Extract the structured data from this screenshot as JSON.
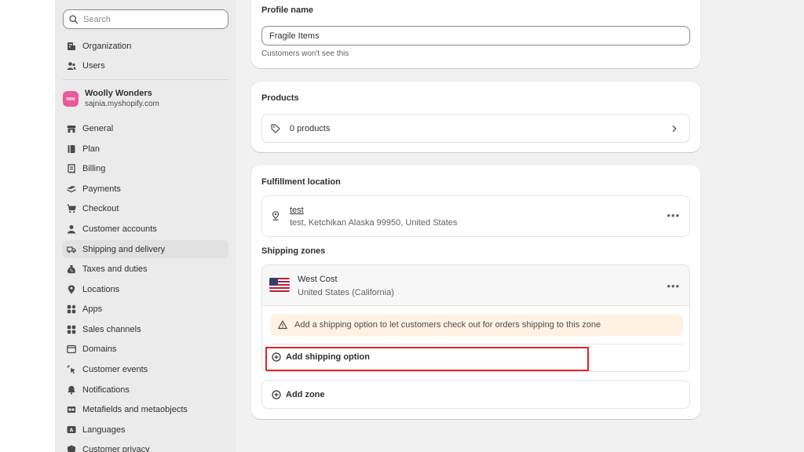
{
  "sidebar": {
    "search_placeholder": "Search",
    "top_items": [
      {
        "label": "Organization",
        "icon": "organization-icon"
      },
      {
        "label": "Users",
        "icon": "users-icon"
      }
    ],
    "store": {
      "initials": "ww",
      "name": "Woolly Wonders",
      "url": "sajnia.myshopify.com",
      "color": "#e85a9c"
    },
    "items": [
      {
        "label": "General",
        "icon": "store-icon"
      },
      {
        "label": "Plan",
        "icon": "plan-icon"
      },
      {
        "label": "Billing",
        "icon": "billing-icon"
      },
      {
        "label": "Payments",
        "icon": "payments-icon"
      },
      {
        "label": "Checkout",
        "icon": "cart-icon"
      },
      {
        "label": "Customer accounts",
        "icon": "person-icon"
      },
      {
        "label": "Shipping and delivery",
        "icon": "truck-icon",
        "active": true
      },
      {
        "label": "Taxes and duties",
        "icon": "tax-icon"
      },
      {
        "label": "Locations",
        "icon": "location-icon"
      },
      {
        "label": "Apps",
        "icon": "apps-icon"
      },
      {
        "label": "Sales channels",
        "icon": "channels-icon"
      },
      {
        "label": "Domains",
        "icon": "globe-icon"
      },
      {
        "label": "Customer events",
        "icon": "cursor-icon"
      },
      {
        "label": "Notifications",
        "icon": "bell-icon"
      },
      {
        "label": "Metafields and metaobjects",
        "icon": "metafields-icon"
      },
      {
        "label": "Languages",
        "icon": "language-icon"
      },
      {
        "label": "Customer privacy",
        "icon": "privacy-icon"
      }
    ]
  },
  "profile": {
    "title": "Profile name",
    "value": "Fragile Items",
    "hint": "Customers won't see this"
  },
  "products": {
    "title": "Products",
    "count_label": "0 products"
  },
  "fulfillment": {
    "title": "Fulfillment location",
    "location_name": "test",
    "location_address": "test, Ketchikan Alaska 99950, United States",
    "zones_title": "Shipping zones",
    "zone_name": "West Cost",
    "zone_region": "United States (California)",
    "warning": "Add a shipping option to let customers check out for orders shipping to this zone",
    "add_option_label": "Add shipping option",
    "add_zone_label": "Add zone"
  },
  "colors": {
    "highlight": "#e02424",
    "warning_bg": "#fff1e3",
    "active_nav": "#e1e1e1"
  }
}
